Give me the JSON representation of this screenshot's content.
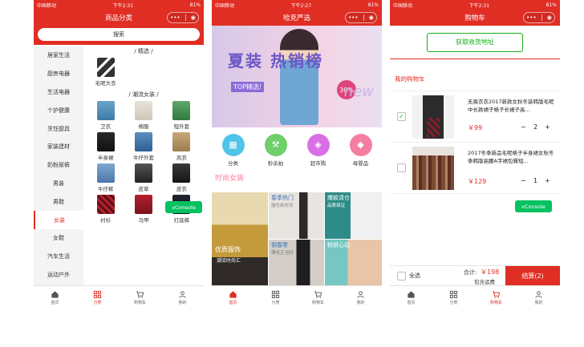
{
  "status": {
    "carrier": "中国移动",
    "battery": "81%",
    "times": [
      "下午2:31",
      "下午2:27",
      "下午2:31"
    ]
  },
  "capsule": {
    "dots": "•••"
  },
  "phone1": {
    "title": "商品分类",
    "search": "搜索",
    "sidebar": [
      "居家生活",
      "厨房电器",
      "生活电器",
      "个护健康",
      "烹饪厨具",
      "家装建材",
      "奶粉尿裤",
      "男装",
      "男鞋",
      "女装",
      "女鞋",
      "汽车生活",
      "运动户外"
    ],
    "active_index": 9,
    "section1_title": "/ 精选 /",
    "section1_items": [
      "毛呢大衣"
    ],
    "section2_title": "/ 潮流女装 /",
    "section2_items": [
      "卫衣",
      "棉服",
      "短外套",
      "半身裙",
      "牛仔外套",
      "风衣",
      "牛仔裤",
      "皮草",
      "皮衣",
      "衬衫",
      "马甲",
      "打底裤"
    ],
    "vconsole": "vConsole"
  },
  "phone2": {
    "title": "哈克严选",
    "banner": {
      "headline": "夏装  热销榜",
      "top": "TOP精选!",
      "off": "30%",
      "new": "new"
    },
    "icons": [
      "分类",
      "秒杀拍",
      "超市购",
      "母婴品"
    ],
    "fashion_title": "时尚女装",
    "tiles": {
      "main": "优质服饰",
      "main_sub": "潮流时尚汇",
      "spring": "春季热门",
      "spring_sub": "撞色新时尚",
      "hot": "爆款清仓",
      "hot_sub": "品质保证",
      "sheer": "倒春寒",
      "sheer_sub": "薄毛正当时",
      "girl": "粉妍心动"
    }
  },
  "phone3": {
    "title": "购物车",
    "address_button": "获取收货地址",
    "my_cart": "我的购物车",
    "items": [
      {
        "title": "无畏衣衣2017新款女秋冬装韩版毛呢中长款裙子格子长裙子高...",
        "price": "￥99",
        "qty": "2",
        "checked": true
      },
      {
        "title": "2017冬季新品毛呢格子半身裙女秋冬季韩版高腰A字裙包臀短...",
        "price": "￥129",
        "qty": "1",
        "checked": false
      }
    ],
    "minus": "−",
    "plus": "+",
    "select_all": "全选",
    "total_label": "合计:",
    "total_value": "￥198",
    "shipping": "包含运费",
    "checkout": "结算(2)",
    "vconsole": "vConsole"
  },
  "tabs": [
    "首页",
    "分类",
    "购物车",
    "我的"
  ],
  "colors": {
    "brand_red": "#e02e24",
    "wechat_green": "#07c160",
    "checkout_green": "#1aad19"
  }
}
